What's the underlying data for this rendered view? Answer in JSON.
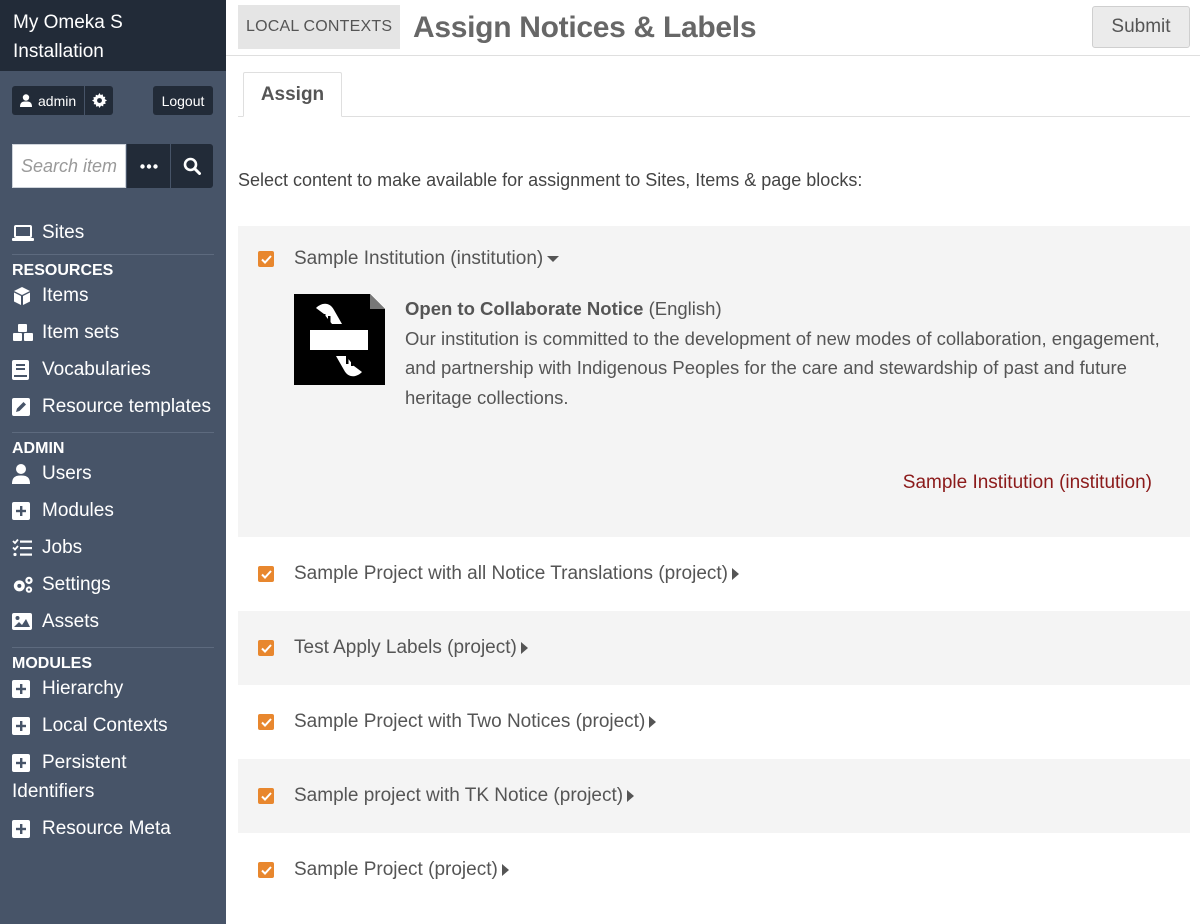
{
  "sidebar": {
    "brand": "My Omeka S Installation",
    "user": "admin",
    "logout": "Logout",
    "search_placeholder": "Search items",
    "sites": "Sites",
    "sections": {
      "resources": "RESOURCES",
      "admin": "ADMIN",
      "modules": "MODULES"
    },
    "resources": [
      "Items",
      "Item sets",
      "Vocabularies",
      "Resource templates"
    ],
    "admin": [
      "Users",
      "Modules",
      "Jobs",
      "Settings",
      "Assets"
    ],
    "modules": [
      "Hierarchy",
      "Local Contexts",
      "Persistent Identifiers",
      "Resource Meta"
    ]
  },
  "header": {
    "breadcrumb": "LOCAL CONTEXTS",
    "title": "Assign Notices & Labels",
    "submit": "Submit"
  },
  "tabs": {
    "assign": "Assign"
  },
  "intro": "Select content to make available for assignment to Sites, Items & page blocks:",
  "rows": [
    {
      "label": "Sample Institution (institution)",
      "expanded": true,
      "notice": {
        "title": "Open to Collaborate Notice",
        "lang": " (English)",
        "text": "Our institution is committed to the development of new modes of collaboration, engagement, and partnership with Indigenous Peoples for the care and stewardship of past and future heritage collections."
      },
      "link": "Sample Institution (institution)"
    },
    {
      "label": "Sample Project with all Notice Translations (project)"
    },
    {
      "label": "Test Apply Labels (project)"
    },
    {
      "label": "Sample Project with Two Notices (project)"
    },
    {
      "label": "Sample project with TK Notice (project)"
    },
    {
      "label": "Sample Project (project)"
    }
  ],
  "colors": {
    "sidebar_bg": "#475468",
    "sidebar_dark": "#222b38",
    "checkbox": "#e8872e",
    "link": "#8b1a1a"
  }
}
